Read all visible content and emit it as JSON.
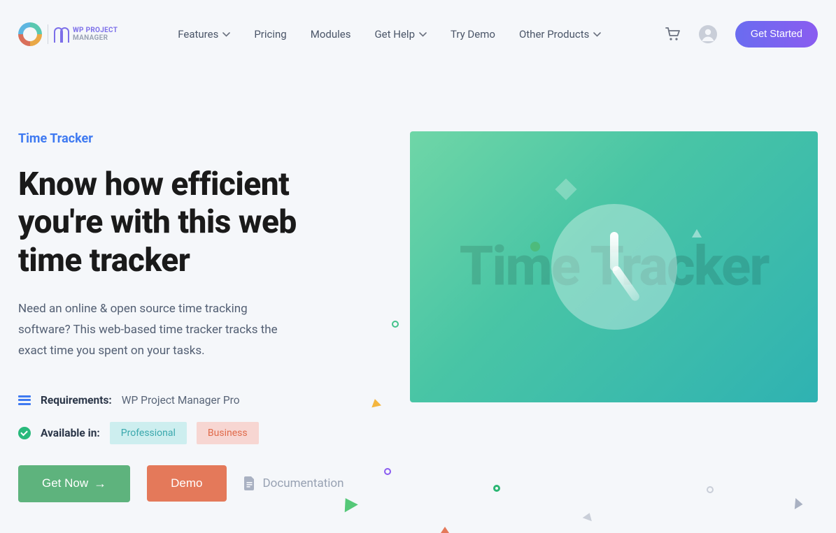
{
  "brand": {
    "line1": "WP PROJECT",
    "line2": "MANAGER"
  },
  "nav": {
    "features": "Features",
    "pricing": "Pricing",
    "modules": "Modules",
    "getHelp": "Get Help",
    "tryDemo": "Try Demo",
    "otherProducts": "Other Products"
  },
  "header": {
    "getStarted": "Get Started"
  },
  "hero": {
    "eyebrow": "Time Tracker",
    "headline": "Know how efficient you're with this web time tracker",
    "description": "Need an online & open source time tracking software? This web-based time tracker tracks the exact time you spent on your tasks.",
    "illustrationText": "Time Tracker"
  },
  "meta": {
    "requirementsLabel": "Requirements:",
    "requirementsValue": "WP Project Manager Pro",
    "availableLabel": "Available in:",
    "plans": {
      "professional": "Professional",
      "business": "Business"
    }
  },
  "cta": {
    "getNow": "Get Now",
    "demo": "Demo",
    "documentation": "Documentation"
  }
}
